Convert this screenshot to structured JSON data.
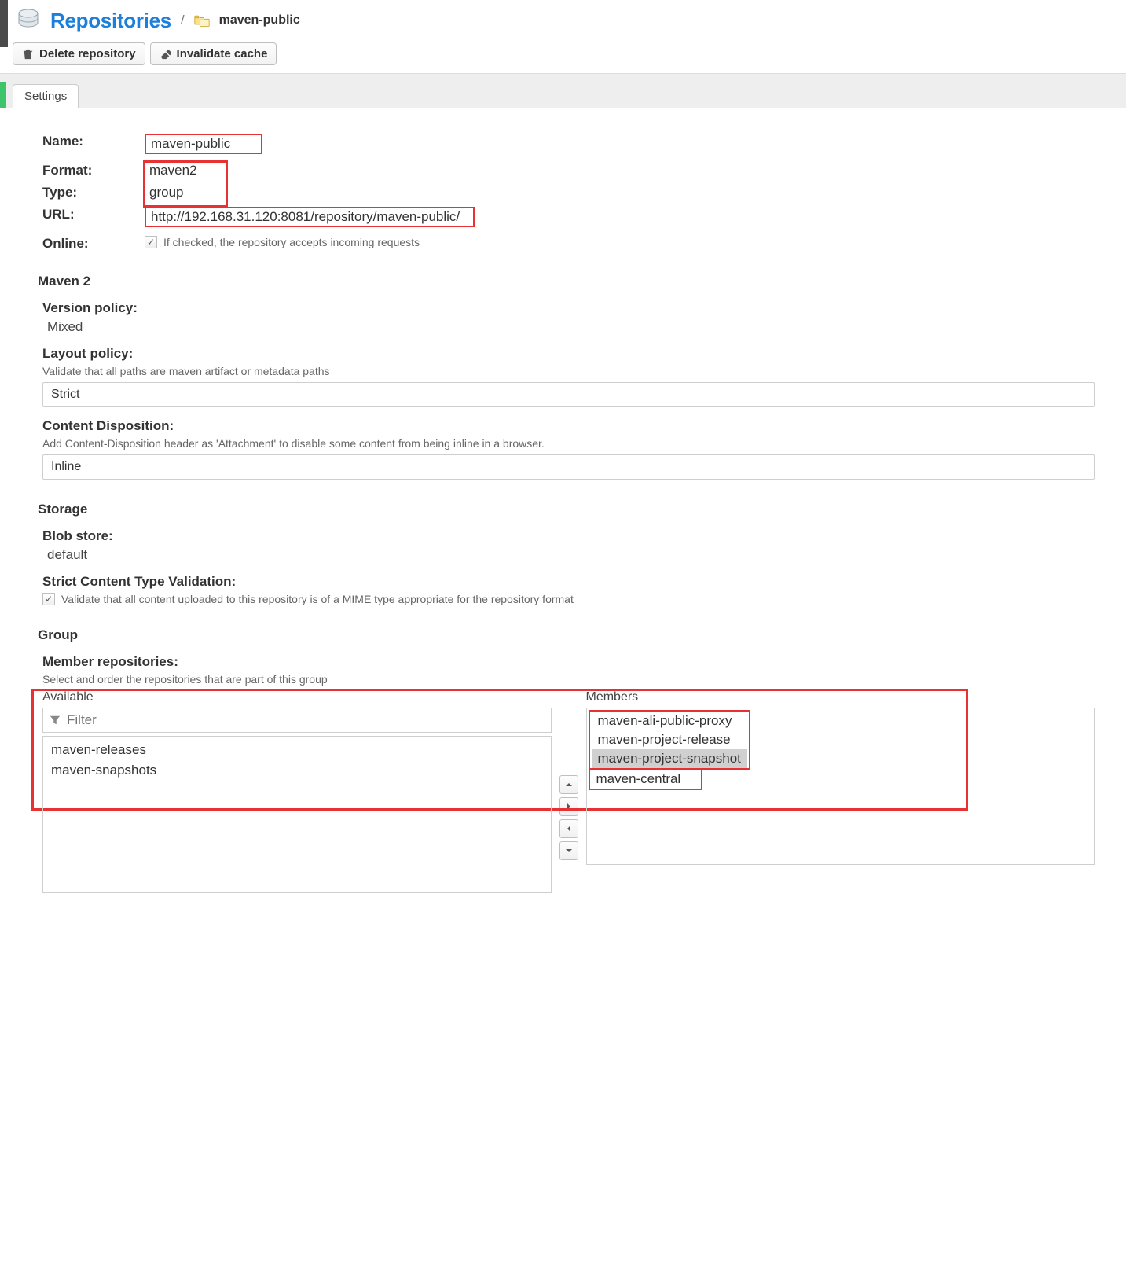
{
  "header": {
    "title": "Repositories",
    "breadcrumb_name": "maven-public"
  },
  "toolbar": {
    "delete_label": "Delete repository",
    "invalidate_label": "Invalidate cache"
  },
  "tab": {
    "settings_label": "Settings"
  },
  "props": {
    "name_label": "Name:",
    "name_value": "maven-public",
    "format_label": "Format:",
    "format_value": "maven2",
    "type_label": "Type:",
    "type_value": "group",
    "url_label": "URL:",
    "url_value": "http://192.168.31.120:8081/repository/maven-public/",
    "online_label": "Online:",
    "online_help": "If checked, the repository accepts incoming requests"
  },
  "maven2": {
    "title": "Maven 2",
    "version_label": "Version policy:",
    "version_value": "Mixed",
    "layout_label": "Layout policy:",
    "layout_help": "Validate that all paths are maven artifact or metadata paths",
    "layout_value": "Strict",
    "cd_label": "Content Disposition:",
    "cd_help": "Add Content-Disposition header as 'Attachment' to disable some content from being inline in a browser.",
    "cd_value": "Inline"
  },
  "storage": {
    "title": "Storage",
    "blob_label": "Blob store:",
    "blob_value": "default",
    "strict_label": "Strict Content Type Validation:",
    "strict_help": "Validate that all content uploaded to this repository is of a MIME type appropriate for the repository format"
  },
  "group": {
    "title": "Group",
    "members_label": "Member repositories:",
    "members_help": "Select and order the repositories that are part of this group",
    "available_label": "Available",
    "members_head": "Members",
    "filter_placeholder": "Filter",
    "available_items": [
      "maven-releases",
      "maven-snapshots"
    ],
    "member_items": [
      "maven-ali-public-proxy",
      "maven-project-release",
      "maven-project-snapshot",
      "maven-central"
    ]
  }
}
